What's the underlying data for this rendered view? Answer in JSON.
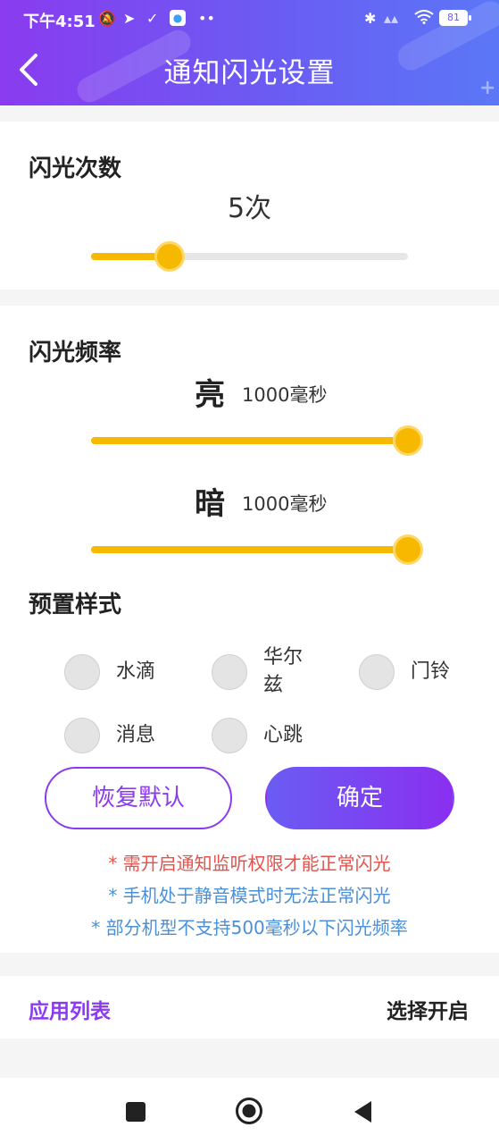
{
  "status_bar": {
    "time": "下午4:51",
    "battery": "81"
  },
  "header": {
    "title": "通知闪光设置"
  },
  "flash_count": {
    "title": "闪光次数",
    "value_text": "5次",
    "slider_level": 0.25
  },
  "flash_frequency": {
    "title": "闪光频率",
    "bright": {
      "label": "亮",
      "value": "1000毫秒",
      "slider_level": 1.0
    },
    "dark": {
      "label": "暗",
      "value": "1000毫秒",
      "slider_level": 1.0
    }
  },
  "preset_styles": {
    "title": "预置样式",
    "options": [
      "水滴",
      "华尔兹",
      "门铃",
      "消息",
      "心跳"
    ]
  },
  "buttons": {
    "reset": "恢复默认",
    "confirm": "确定"
  },
  "notes": [
    {
      "text": "* 需开启通知监听权限才能正常闪光",
      "color": "#e8514a"
    },
    {
      "text": "* 手机处于静音模式时无法正常闪光",
      "color": "#4a90d9"
    },
    {
      "text": "* 部分机型不支持500毫秒以下闪光频率",
      "color": "#4a90d9"
    }
  ],
  "app_list": {
    "label": "应用列表",
    "action": "选择开启"
  },
  "colors": {
    "accent": "#8a3bef",
    "slider": "#f6b900"
  },
  "icons": {
    "back": "chevron-left-icon",
    "nav_recent": "square-icon",
    "nav_home": "circle-icon",
    "nav_back": "triangle-left-icon"
  }
}
